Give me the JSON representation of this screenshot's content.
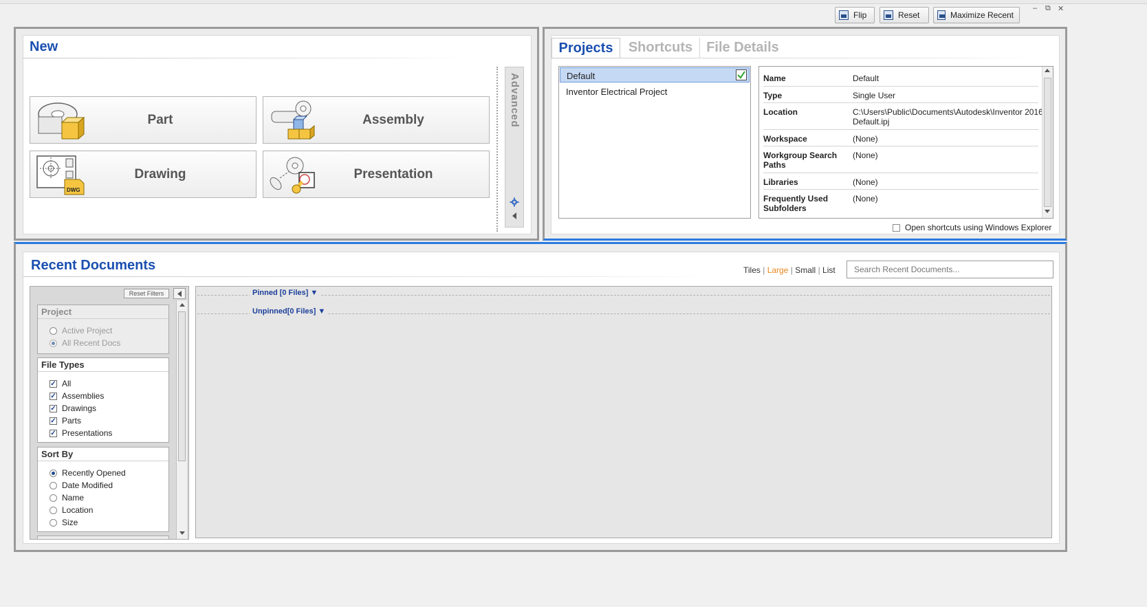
{
  "toolbar": {
    "flip_label": "Flip",
    "reset_label": "Reset",
    "maximize_label": "Maximize Recent"
  },
  "window_controls": {
    "minimize": "–",
    "restore": "⧉",
    "close": "✕"
  },
  "new_panel": {
    "title": "New",
    "buttons": [
      {
        "label": "Part",
        "icon": "part-icon"
      },
      {
        "label": "Assembly",
        "icon": "assembly-icon"
      },
      {
        "label": "Drawing",
        "icon": "drawing-icon",
        "badge": "DWG"
      },
      {
        "label": "Presentation",
        "icon": "presentation-icon"
      }
    ],
    "advanced_label": "Advanced"
  },
  "projects_panel": {
    "tabs": [
      "Projects",
      "Shortcuts",
      "File Details"
    ],
    "active_tab": "Projects",
    "projects": [
      {
        "name": "Default",
        "active": true
      },
      {
        "name": "Inventor Electrical Project",
        "active": false
      }
    ],
    "details": [
      {
        "key": "Name",
        "value": "Default"
      },
      {
        "key": "Type",
        "value": "Single User"
      },
      {
        "key": "Location",
        "value": "C:\\Users\\Public\\Documents\\Autodesk\\Inventor 2016\\",
        "value2": "Default.ipj"
      },
      {
        "key": "Workspace",
        "value": "(None)"
      },
      {
        "key": "Workgroup Search",
        "key2": "Paths",
        "value": "(None)"
      },
      {
        "key": "Libraries",
        "value": "(None)"
      },
      {
        "key": "Frequently Used",
        "key2": "Subfolders",
        "value": "(None)"
      }
    ],
    "open_shortcuts_label": "Open shortcuts using Windows Explorer"
  },
  "recent_panel": {
    "title": "Recent Documents",
    "views": {
      "tiles": "Tiles",
      "large": "Large",
      "small": "Small",
      "list": "List",
      "sep": "|"
    },
    "active_view": "Large",
    "search_placeholder": "Search Recent Documents...",
    "reset_filters_label": "Reset Filters",
    "project_group": {
      "title": "Project",
      "options": [
        "Active Project",
        "All Recent Docs"
      ],
      "selected": "All Recent Docs"
    },
    "file_types": {
      "title": "File Types",
      "options": [
        "All",
        "Assemblies",
        "Drawings",
        "Parts",
        "Presentations"
      ]
    },
    "sort_by": {
      "title": "Sort By",
      "options": [
        "Recently Opened",
        "Date Modified",
        "Name",
        "Location",
        "Size"
      ],
      "selected": "Recently Opened"
    },
    "pinned_label": "Pinned [0 Files] ▼",
    "unpinned_label": "Unpinned[0 Files] ▼"
  },
  "colors": {
    "accent": "#1a4fb0",
    "active_view": "#e8861c",
    "selection": "#c6d9f4"
  }
}
